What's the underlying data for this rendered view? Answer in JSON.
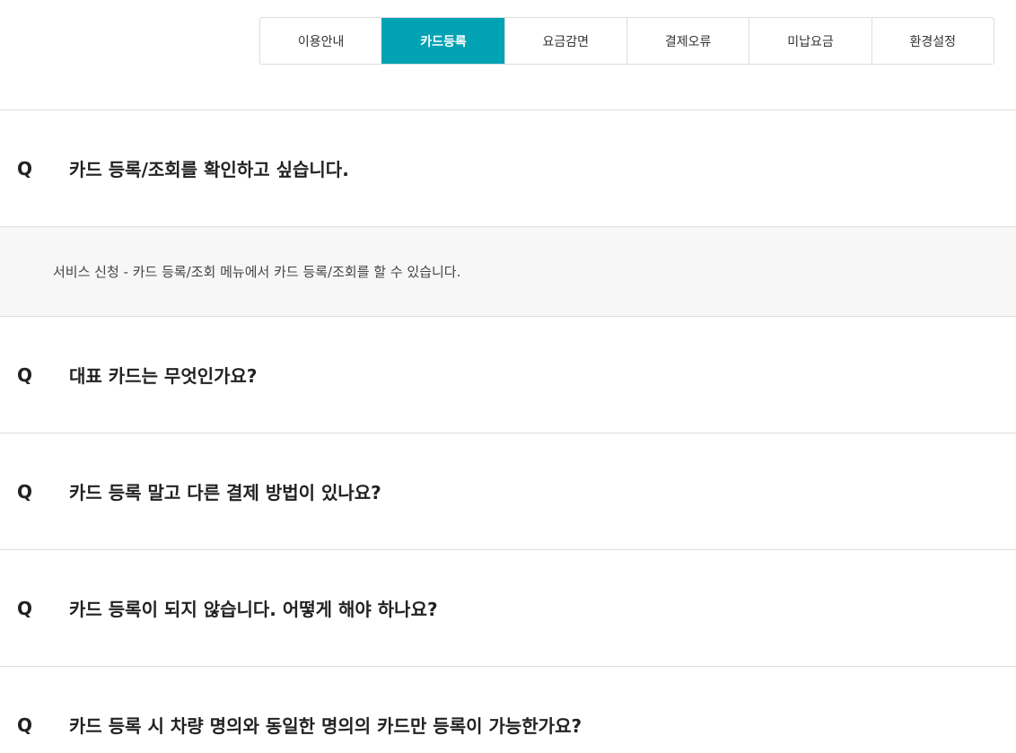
{
  "accent_color": "#00a2b4",
  "tabs": [
    {
      "label": "이용안내",
      "active": false
    },
    {
      "label": "카드등록",
      "active": true
    },
    {
      "label": "요금감면",
      "active": false
    },
    {
      "label": "결제오류",
      "active": false
    },
    {
      "label": "미납요금",
      "active": false
    },
    {
      "label": "환경설정",
      "active": false
    }
  ],
  "faq": {
    "q_mark": "Q",
    "items": [
      {
        "question": "카드 등록/조회를 확인하고 싶습니다.",
        "answer": "서비스 신청 - 카드 등록/조회 메뉴에서 카드 등록/조회를 할 수 있습니다.",
        "expanded": true
      },
      {
        "question": "대표 카드는 무엇인가요?",
        "expanded": false
      },
      {
        "question": "카드 등록 말고 다른 결제 방법이 있나요?",
        "expanded": false
      },
      {
        "question": "카드 등록이 되지 않습니다. 어떻게 해야 하나요?",
        "expanded": false
      },
      {
        "question": "카드 등록 시 차량 명의와 동일한 명의의 카드만 등록이 가능한가요?",
        "expanded": false
      }
    ]
  }
}
